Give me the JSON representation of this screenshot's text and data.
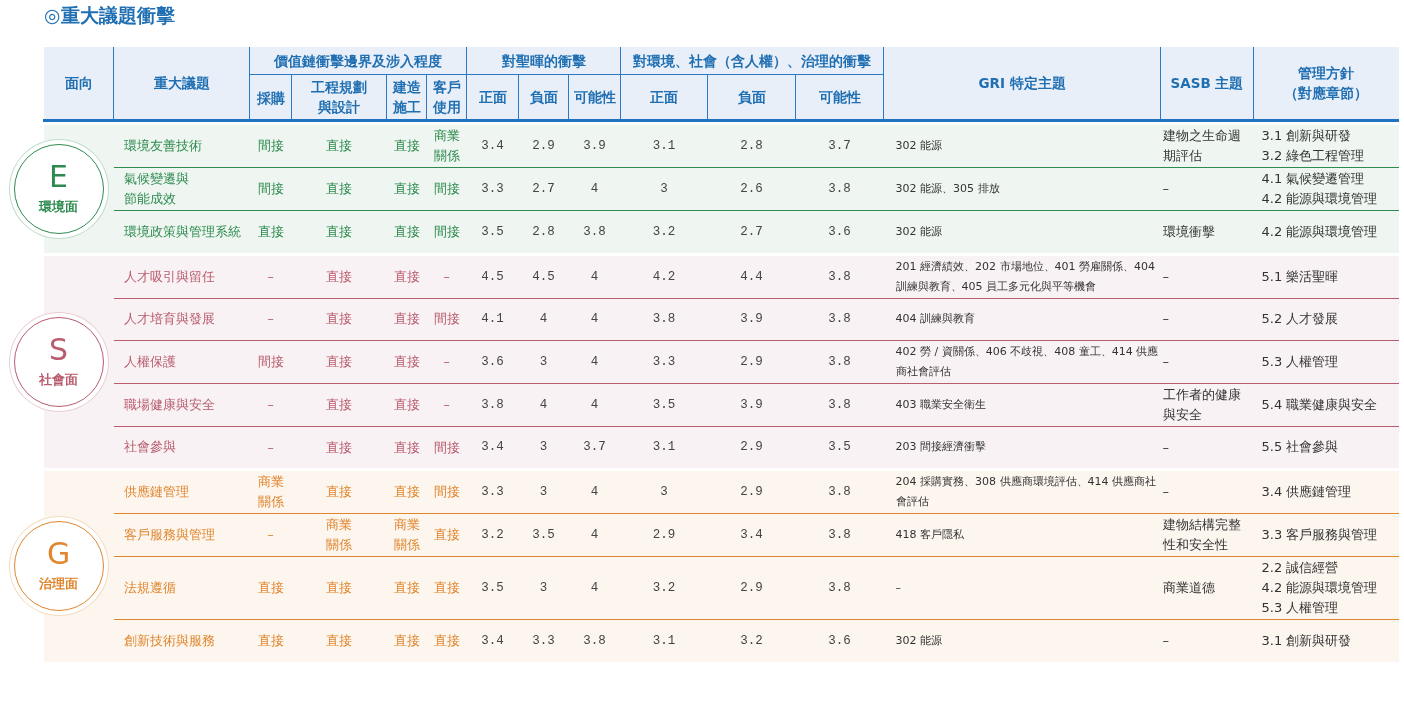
{
  "title": "◎重大議題衝擊",
  "header": {
    "aspect": "面向",
    "topic": "重大議題",
    "value_chain": {
      "label": "價值鏈衝擊邊界及涉入程度",
      "columns": [
        "採購",
        "工程規劃與設計",
        "建造施工",
        "客戶使用"
      ]
    },
    "company_impact": {
      "label": "對聖暉的衝擊",
      "columns": [
        "正面",
        "負面",
        "可能性"
      ]
    },
    "external_impact": {
      "label": "對環境、社會（含人權）、治理的衝擊",
      "columns": [
        "正面",
        "負面",
        "可能性"
      ]
    },
    "gri": "GRI 特定主題",
    "sasb": "SASB 主題",
    "policy": [
      "管理方針",
      "（對應章節）"
    ]
  },
  "groups": [
    {
      "letter": "E",
      "name": "環境面",
      "color": "#2e8b4f",
      "rows": [
        {
          "topic": [
            "環境友善技術"
          ],
          "chain": [
            "間接",
            "直接",
            "直接",
            "商業關係"
          ],
          "company": [
            "3.4",
            "2.9",
            "3.9"
          ],
          "external": [
            "3.1",
            "2.8",
            "3.7"
          ],
          "gri": "302 能源",
          "sasb": "建物之生命週期評估",
          "policy": [
            "3.1 創新與研發",
            "3.2 綠色工程管理"
          ]
        },
        {
          "topic": [
            "氣候變遷與",
            "節能成效"
          ],
          "chain": [
            "間接",
            "直接",
            "直接",
            "間接"
          ],
          "company": [
            "3.3",
            "2.7",
            "4"
          ],
          "external": [
            "3",
            "2.6",
            "3.8"
          ],
          "gri": "302 能源、305 排放",
          "sasb": "–",
          "policy": [
            "4.1 氣候變遷管理",
            "4.2 能源與環境管理"
          ]
        },
        {
          "topic": [
            "環境政策與管理系統"
          ],
          "chain": [
            "直接",
            "直接",
            "直接",
            "間接"
          ],
          "company": [
            "3.5",
            "2.8",
            "3.8"
          ],
          "external": [
            "3.2",
            "2.7",
            "3.6"
          ],
          "gri": "302 能源",
          "sasb": "環境衝擊",
          "policy": [
            "4.2 能源與環境管理"
          ]
        }
      ]
    },
    {
      "letter": "S",
      "name": "社會面",
      "color": "#b85c6e",
      "rows": [
        {
          "topic": [
            "人才吸引與留任"
          ],
          "chain": [
            "–",
            "直接",
            "直接",
            "–"
          ],
          "company": [
            "4.5",
            "4.5",
            "4"
          ],
          "external": [
            "4.2",
            "4.4",
            "3.8"
          ],
          "gri": "201 經濟績效、202 市場地位、401 勞雇關係、404 訓練與教育、405 員工多元化與平等機會",
          "sasb": "–",
          "policy": [
            "5.1 樂活聖暉"
          ]
        },
        {
          "topic": [
            "人才培育與發展"
          ],
          "chain": [
            "–",
            "直接",
            "直接",
            "間接"
          ],
          "company": [
            "4.1",
            "4",
            "4"
          ],
          "external": [
            "3.8",
            "3.9",
            "3.8"
          ],
          "gri": "404 訓練與教育",
          "sasb": "–",
          "policy": [
            "5.2 人才發展"
          ]
        },
        {
          "topic": [
            "人權保護"
          ],
          "chain": [
            "間接",
            "直接",
            "直接",
            "–"
          ],
          "company": [
            "3.6",
            "3",
            "4"
          ],
          "external": [
            "3.3",
            "2.9",
            "3.8"
          ],
          "gri": "402 勞 / 資關係、406 不歧視、408 童工、414 供應商社會評估",
          "sasb": "–",
          "policy": [
            "5.3 人權管理"
          ]
        },
        {
          "topic": [
            "職場健康與安全"
          ],
          "chain": [
            "–",
            "直接",
            "直接",
            "–"
          ],
          "company": [
            "3.8",
            "4",
            "4"
          ],
          "external": [
            "3.5",
            "3.9",
            "3.8"
          ],
          "gri": "403 職業安全衛生",
          "sasb": "工作者的健康與安全",
          "policy": [
            "5.4 職業健康與安全"
          ]
        },
        {
          "topic": [
            "社會參與"
          ],
          "chain": [
            "–",
            "直接",
            "直接",
            "間接"
          ],
          "company": [
            "3.4",
            "3",
            "3.7"
          ],
          "external": [
            "3.1",
            "2.9",
            "3.5"
          ],
          "gri": "203 間接經濟衝擊",
          "sasb": "–",
          "policy": [
            "5.5 社會參與"
          ]
        }
      ]
    },
    {
      "letter": "G",
      "name": "治理面",
      "color": "#e0862e",
      "rows": [
        {
          "topic": [
            "供應鏈管理"
          ],
          "chain": [
            "商業關係",
            "直接",
            "直接",
            "間接"
          ],
          "company": [
            "3.3",
            "3",
            "4"
          ],
          "external": [
            "3",
            "2.9",
            "3.8"
          ],
          "gri": "204 採購實務、308 供應商環境評估、414 供應商社會評估",
          "sasb": "–",
          "policy": [
            "3.4 供應鏈管理"
          ]
        },
        {
          "topic": [
            "客戶服務與管理"
          ],
          "chain": [
            "–",
            "商業關係",
            "商業關係",
            "直接"
          ],
          "company": [
            "3.2",
            "3.5",
            "4"
          ],
          "external": [
            "2.9",
            "3.4",
            "3.8"
          ],
          "gri": "418 客戶隱私",
          "sasb": "建物結構完整性和安全性",
          "policy": [
            "3.3 客戶服務與管理"
          ]
        },
        {
          "topic": [
            "法規遵循"
          ],
          "chain": [
            "直接",
            "直接",
            "直接",
            "直接"
          ],
          "company": [
            "3.5",
            "3",
            "4"
          ],
          "external": [
            "3.2",
            "2.9",
            "3.8"
          ],
          "gri": "–",
          "sasb": "商業道德",
          "policy": [
            "2.2 誠信經營",
            "4.2 能源與環境管理",
            "5.3 人權管理"
          ]
        },
        {
          "topic": [
            "創新技術與服務"
          ],
          "chain": [
            "直接",
            "直接",
            "直接",
            "直接"
          ],
          "company": [
            "3.4",
            "3.3",
            "3.8"
          ],
          "external": [
            "3.1",
            "3.2",
            "3.6"
          ],
          "gri": "302 能源",
          "sasb": "–",
          "policy": [
            "3.1 創新與研發"
          ]
        }
      ]
    }
  ]
}
